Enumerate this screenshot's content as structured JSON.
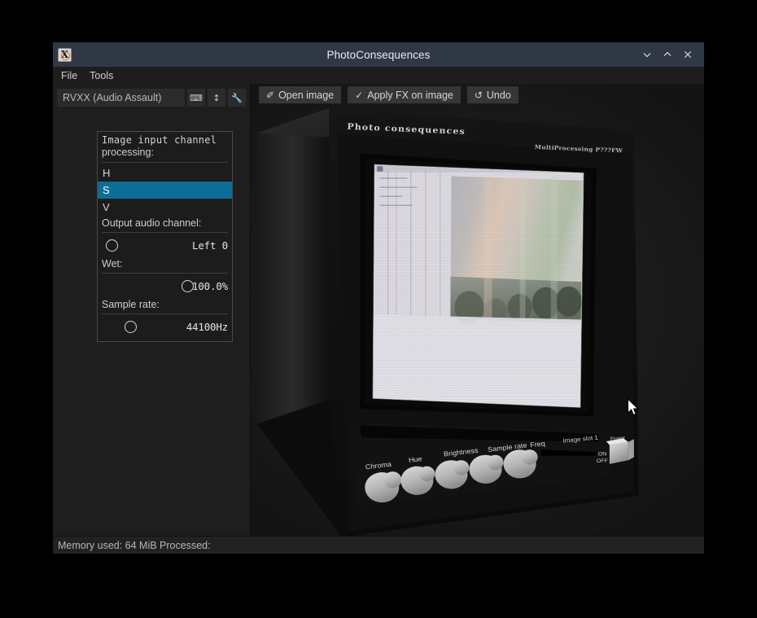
{
  "window": {
    "title": "PhotoConsequences",
    "app_icon": "x11-app-icon",
    "controls": {
      "minimize": "chevron-down-icon",
      "maximize": "chevron-up-icon",
      "close": "close-icon"
    }
  },
  "menubar": {
    "items": [
      {
        "label": "File"
      },
      {
        "label": "Tools"
      }
    ]
  },
  "left_panel": {
    "fx_combo": {
      "value": "RVXX (Audio Assault)"
    },
    "mini_buttons": [
      {
        "name": "keyboard-icon",
        "glyph": "⌨"
      },
      {
        "name": "updown-icon",
        "glyph": "↕"
      },
      {
        "name": "wrench-icon",
        "glyph": "🔧"
      }
    ]
  },
  "popup": {
    "title_line1": "Image input channel",
    "title_line2": "processing:",
    "options": [
      {
        "label": "H",
        "selected": false
      },
      {
        "label": "S",
        "selected": true
      },
      {
        "label": "V",
        "selected": false
      }
    ],
    "sliders": [
      {
        "label": "Output audio channel:",
        "value": "Left 0",
        "knob_pct": 3
      },
      {
        "label": "Wet:",
        "value": "100.0%",
        "knob_pct": 63
      },
      {
        "label": "Sample rate:",
        "value": "44100Hz",
        "knob_pct": 18
      }
    ]
  },
  "toolbar": {
    "buttons": [
      {
        "label": "Open image",
        "icon": "open-image-icon",
        "glyph": "✐"
      },
      {
        "label": "Apply FX on image",
        "icon": "check-icon",
        "glyph": "✓"
      },
      {
        "label": "Undo",
        "icon": "undo-icon",
        "glyph": "↺"
      }
    ]
  },
  "viewport": {
    "monitor": {
      "brand": "Photo consequences",
      "model": "MultiProcessing P???FW",
      "knobs": [
        {
          "label": "Chroma"
        },
        {
          "label": "Hue"
        },
        {
          "label": "Brightness"
        },
        {
          "label": "Sample rate"
        },
        {
          "label": "Freq"
        }
      ],
      "slot_label": "Image slot 1",
      "power_label": "Power",
      "switch_on": "ON",
      "switch_off": "OFF"
    },
    "cursor": "mouse-pointer"
  },
  "statusbar": {
    "text": "Memory used: 64 MiB Processed:"
  },
  "colors": {
    "titlebar": "#303845",
    "accent_selected": "#0d6d96",
    "panel_bg": "#1e1e1e",
    "viewport_bg": "#1c1c1c",
    "button_bg": "#363636"
  }
}
